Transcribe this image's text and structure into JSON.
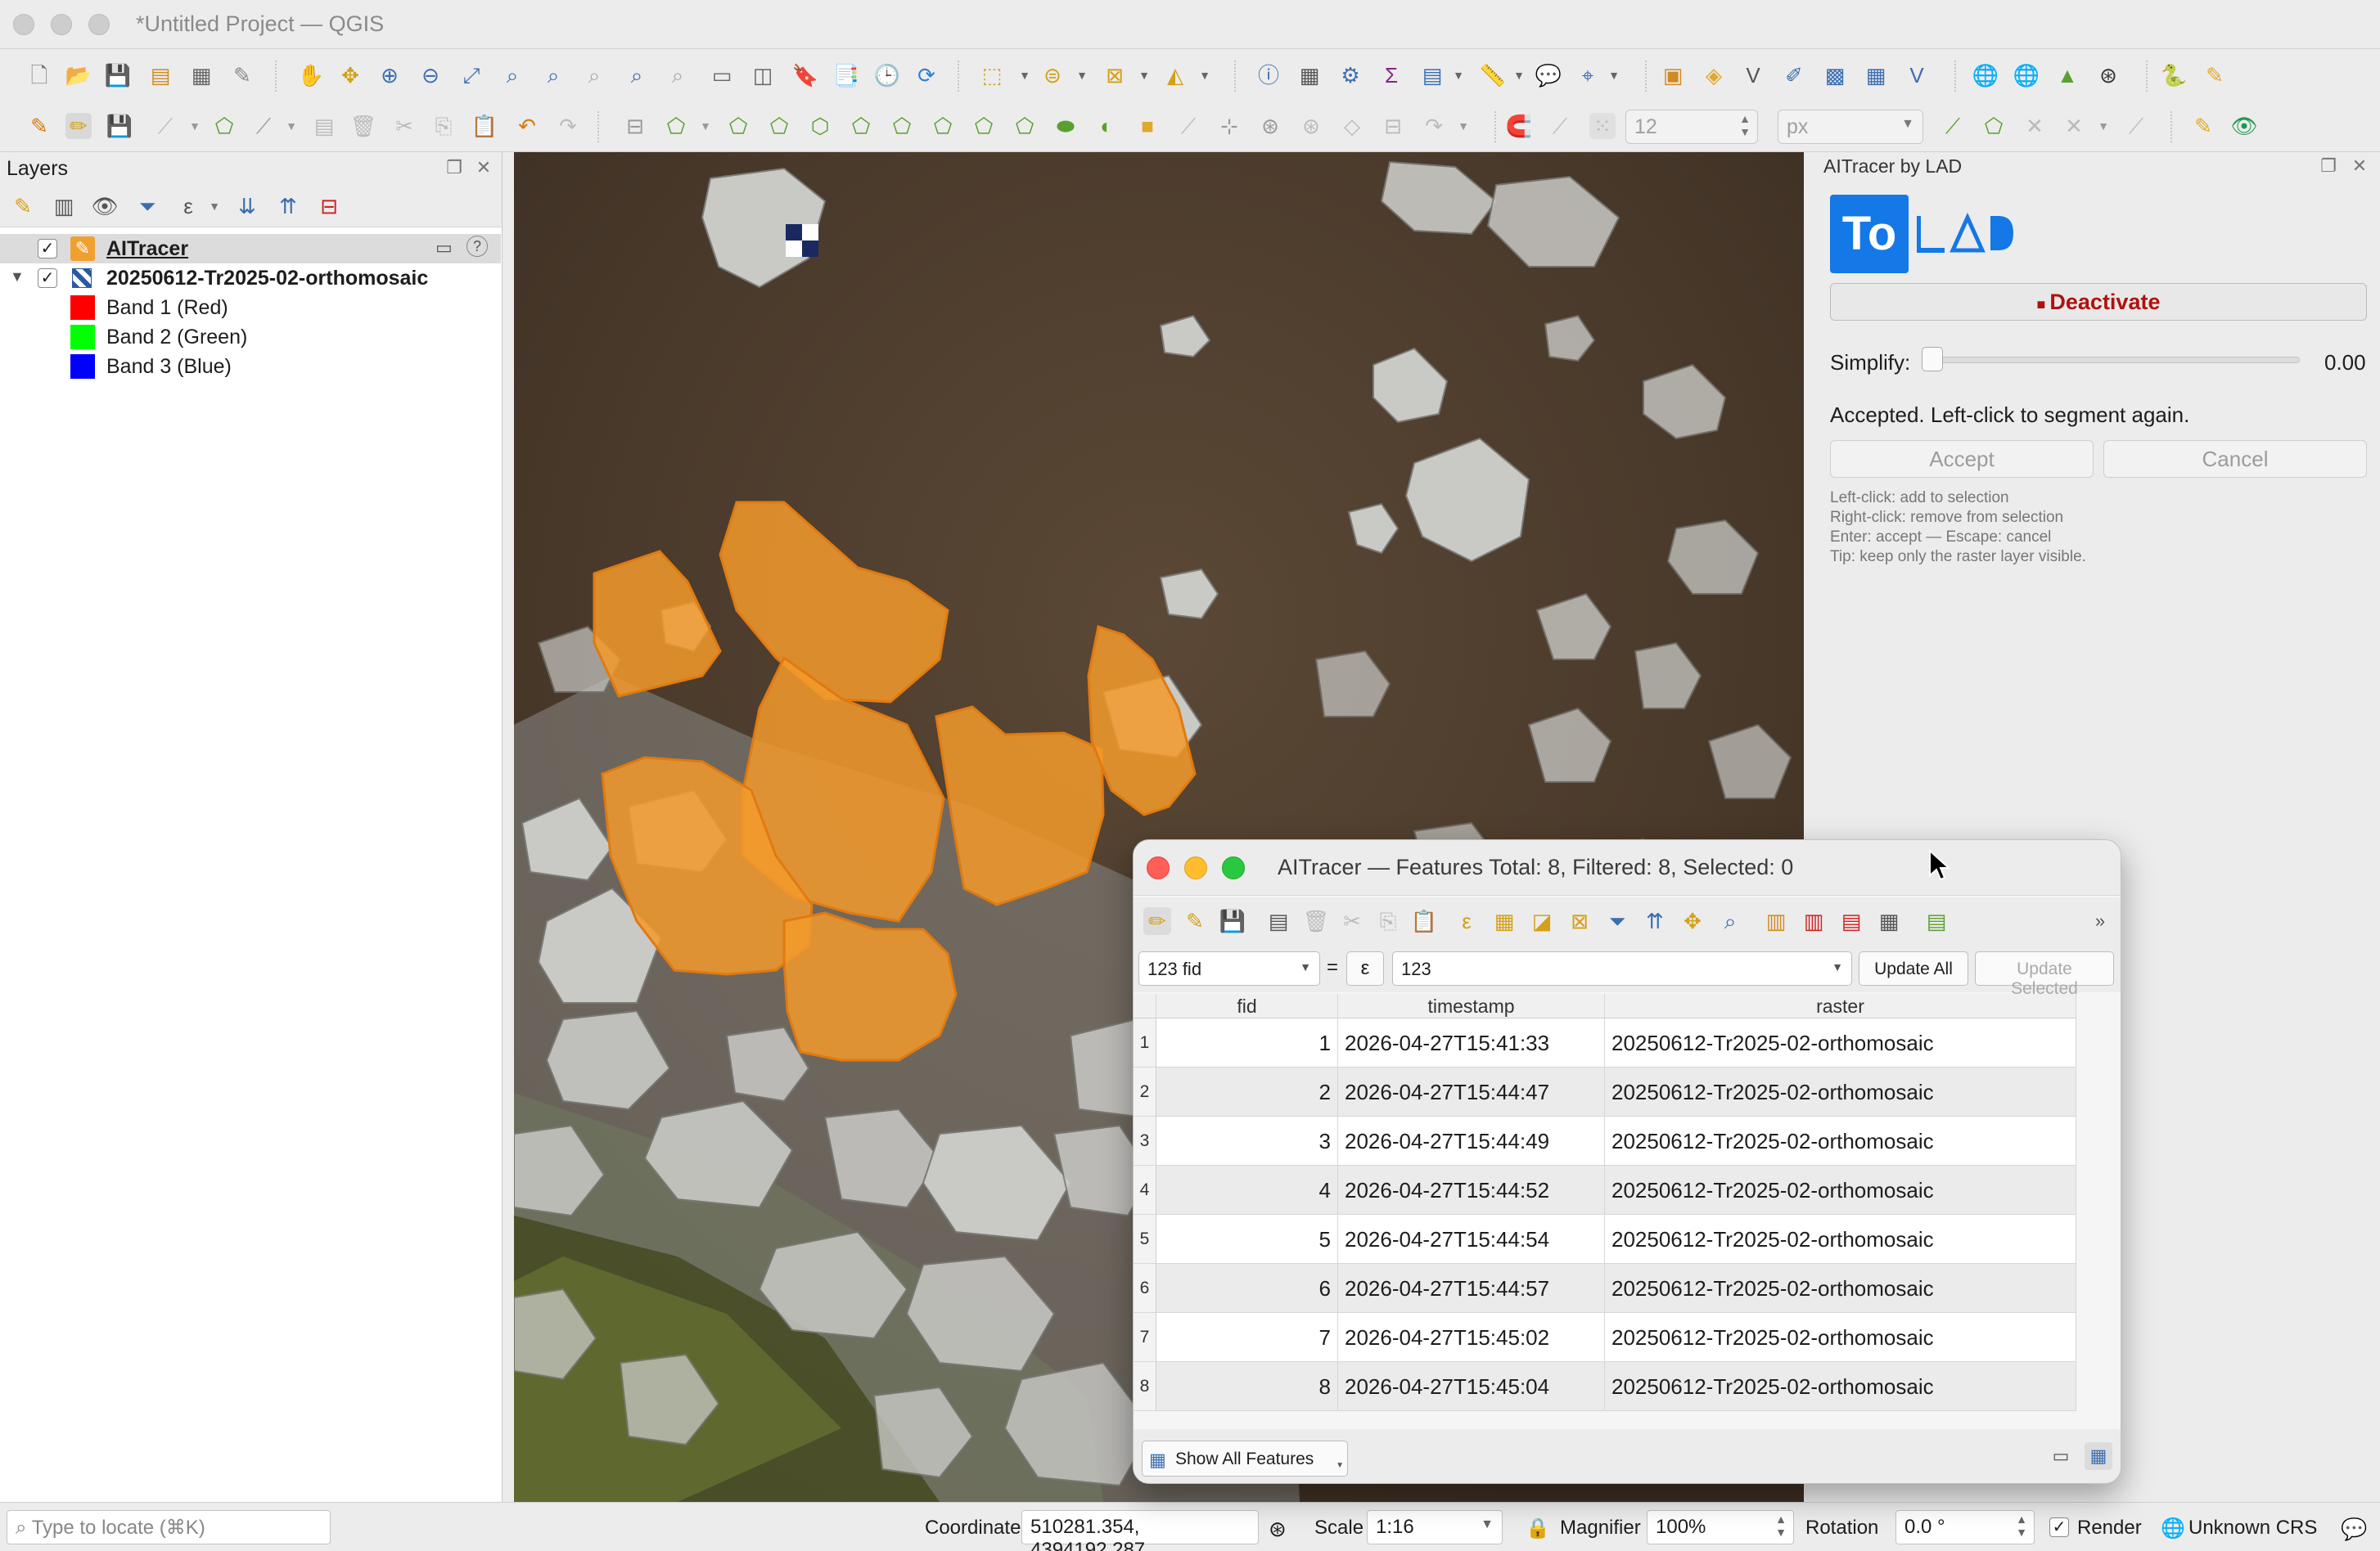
{
  "window": {
    "title": "*Untitled Project — QGIS"
  },
  "toolbar2": {
    "snap_tolerance": "12",
    "snap_units": "px"
  },
  "layers_panel": {
    "title": "Layers",
    "layers": [
      {
        "name": "AITracer",
        "checked": true
      },
      {
        "name": "20250612-Tr2025-02-orthomosaic",
        "checked": true,
        "bands": [
          {
            "name": "Band 1 (Red)",
            "color": "#ff0000"
          },
          {
            "name": "Band 2 (Green)",
            "color": "#00ff00"
          },
          {
            "name": "Band 3 (Blue)",
            "color": "#0000ff"
          }
        ]
      }
    ]
  },
  "plugin": {
    "title": "AITracer by LAD",
    "logo_letters": "To",
    "deactivate_label": "Deactivate",
    "simplify_label": "Simplify:",
    "simplify_value": "0.00",
    "status": "Accepted. Left-click to segment again.",
    "accept_label": "Accept",
    "cancel_label": "Cancel",
    "hints": [
      "Left-click: add to selection",
      "Right-click: remove from selection",
      "Enter: accept — Escape: cancel",
      "Tip: keep only the raster layer visible."
    ],
    "accent_color": "#1478e6",
    "deactivate_color": "#b01010"
  },
  "attribute_table": {
    "title": "AITracer — Features Total: 8, Filtered: 8, Selected: 0",
    "field_select": "123 fid",
    "equals": "=",
    "expr_icon": "ε",
    "expr_value": "123",
    "update_all": "Update All",
    "update_selected": "Update Selected",
    "columns": [
      "fid",
      "timestamp",
      "raster"
    ],
    "rows": [
      {
        "n": "1",
        "fid": "1",
        "timestamp": "2026-04-27T15:41:33",
        "raster": "20250612-Tr2025-02-orthomosaic"
      },
      {
        "n": "2",
        "fid": "2",
        "timestamp": "2026-04-27T15:44:47",
        "raster": "20250612-Tr2025-02-orthomosaic"
      },
      {
        "n": "3",
        "fid": "3",
        "timestamp": "2026-04-27T15:44:49",
        "raster": "20250612-Tr2025-02-orthomosaic"
      },
      {
        "n": "4",
        "fid": "4",
        "timestamp": "2026-04-27T15:44:52",
        "raster": "20250612-Tr2025-02-orthomosaic"
      },
      {
        "n": "5",
        "fid": "5",
        "timestamp": "2026-04-27T15:44:54",
        "raster": "20250612-Tr2025-02-orthomosaic"
      },
      {
        "n": "6",
        "fid": "6",
        "timestamp": "2026-04-27T15:44:57",
        "raster": "20250612-Tr2025-02-orthomosaic"
      },
      {
        "n": "7",
        "fid": "7",
        "timestamp": "2026-04-27T15:45:02",
        "raster": "20250612-Tr2025-02-orthomosaic"
      },
      {
        "n": "8",
        "fid": "8",
        "timestamp": "2026-04-27T15:45:04",
        "raster": "20250612-Tr2025-02-orthomosaic"
      }
    ],
    "show_all": "Show All Features"
  },
  "statusbar": {
    "locate_placeholder": "Type to locate (⌘K)",
    "coordinate_label": "Coordinate",
    "coordinate_value": "510281.354, 4394192.287",
    "scale_label": "Scale",
    "scale_value": "1:16",
    "magnifier_label": "Magnifier",
    "magnifier_value": "100%",
    "rotation_label": "Rotation",
    "rotation_value": "0.0 °",
    "render_label": "Render",
    "crs_label": "Unknown CRS"
  },
  "map": {
    "polygon_color": "#f39a2c"
  }
}
